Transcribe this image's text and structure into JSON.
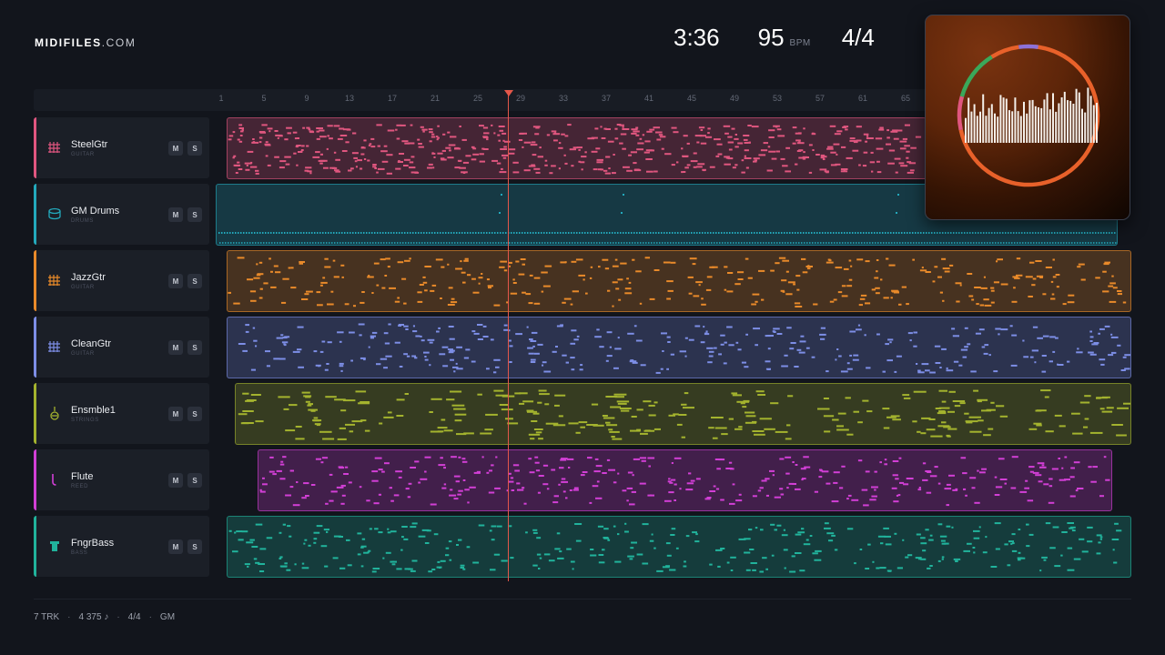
{
  "brand": {
    "name": "MIDIFILES",
    "suffix": ".COM"
  },
  "transport": {
    "time": "3:36",
    "bpm": "95",
    "bpm_label": "BPM",
    "time_signature": "4/4"
  },
  "ruler": {
    "ticks": [
      "1",
      "5",
      "9",
      "13",
      "17",
      "21",
      "25",
      "29",
      "33",
      "37",
      "41",
      "45",
      "49",
      "53",
      "57",
      "61",
      "65"
    ]
  },
  "tracks": [
    {
      "name": "SteelGtr",
      "category": "GUITAR",
      "color": "#e0567f",
      "icon": "guitar-icon",
      "mute_label": "M",
      "solo_label": "S"
    },
    {
      "name": "GM Drums",
      "category": "DRUMS",
      "color": "#23a9bc",
      "icon": "drum-icon",
      "mute_label": "M",
      "solo_label": "S"
    },
    {
      "name": "JazzGtr",
      "category": "GUITAR",
      "color": "#e98a2a",
      "icon": "guitar-icon",
      "mute_label": "M",
      "solo_label": "S"
    },
    {
      "name": "CleanGtr",
      "category": "GUITAR",
      "color": "#7d8ee6",
      "icon": "guitar-icon",
      "mute_label": "M",
      "solo_label": "S"
    },
    {
      "name": "Ensmble1",
      "category": "STRINGS",
      "color": "#a4b32e",
      "icon": "strings-icon",
      "mute_label": "M",
      "solo_label": "S"
    },
    {
      "name": "Flute",
      "category": "REED",
      "color": "#d23fd6",
      "icon": "reed-icon",
      "mute_label": "M",
      "solo_label": "S"
    },
    {
      "name": "FngrBass",
      "category": "BASS",
      "color": "#21b39c",
      "icon": "bass-icon",
      "mute_label": "M",
      "solo_label": "S"
    }
  ],
  "footer": {
    "tracks": "7 TRK",
    "notes": "4 375 ♪",
    "time_signature": "4/4",
    "standard": "GM"
  },
  "album_art": {
    "icon": "album-art-visualizer-icon"
  }
}
